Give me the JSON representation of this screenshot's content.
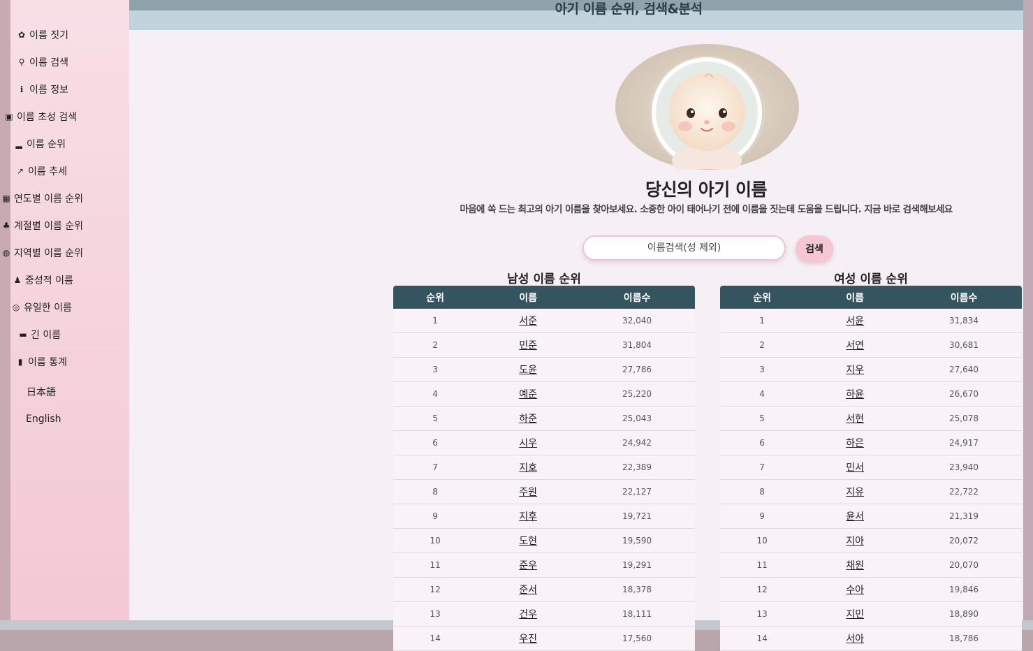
{
  "site_title": "아기 이름 순위, 검색&분석",
  "sidebar": {
    "items": [
      {
        "icon": "baby-icon",
        "glyph": "✿",
        "label": "이름 짓기"
      },
      {
        "icon": "search-icon",
        "glyph": "⚲",
        "label": "이름 검색"
      },
      {
        "icon": "info-icon",
        "glyph": "ℹ",
        "label": "이름 정보"
      },
      {
        "icon": "language-icon",
        "glyph": "▣",
        "label": "이름 초성 검색"
      },
      {
        "icon": "ranking-icon",
        "glyph": "▂",
        "label": "이름 순위"
      },
      {
        "icon": "trend-icon",
        "glyph": "↗",
        "label": "이름 추세"
      },
      {
        "icon": "calendar-icon",
        "glyph": "▦",
        "label": "연도별 이름 순위"
      },
      {
        "icon": "tree-icon",
        "glyph": "♣",
        "label": "계절별 이름 순위"
      },
      {
        "icon": "globe-icon",
        "glyph": "◍",
        "label": "지역별 이름 순위"
      },
      {
        "icon": "person-icon",
        "glyph": "♟",
        "label": "중성적 이름"
      },
      {
        "icon": "fingerprint-icon",
        "glyph": "◎",
        "label": "유일한 이름"
      },
      {
        "icon": "ruler-icon",
        "glyph": "▬",
        "label": "긴 이름"
      },
      {
        "icon": "chart-icon",
        "glyph": "▮",
        "label": "이름 통계"
      }
    ],
    "languages": [
      "日本語",
      "English"
    ]
  },
  "hero": {
    "title": "당신의 아기 이름",
    "subtitle": "마음에 쏙 드는 최고의 아기 이름을 찾아보세요. 소중한 아이 태어나기 전에 이름을 짓는데 도움을 드립니다. 지금 바로 검색해보세요"
  },
  "search": {
    "placeholder": "이름검색(성 제외)",
    "button": "검색"
  },
  "tables": {
    "headers": [
      "순위",
      "이름",
      "이름수"
    ],
    "male": {
      "title": "남성 이름 순위",
      "rows": [
        [
          "1",
          "서준",
          "32,040"
        ],
        [
          "2",
          "민준",
          "31,804"
        ],
        [
          "3",
          "도윤",
          "27,786"
        ],
        [
          "4",
          "예준",
          "25,220"
        ],
        [
          "5",
          "하준",
          "25,043"
        ],
        [
          "6",
          "시우",
          "24,942"
        ],
        [
          "7",
          "지호",
          "22,389"
        ],
        [
          "8",
          "주원",
          "22,127"
        ],
        [
          "9",
          "지후",
          "19,721"
        ],
        [
          "10",
          "도현",
          "19,590"
        ],
        [
          "11",
          "준우",
          "19,291"
        ],
        [
          "12",
          "준서",
          "18,378"
        ],
        [
          "13",
          "건우",
          "18,111"
        ],
        [
          "14",
          "우진",
          "17,560"
        ]
      ]
    },
    "female": {
      "title": "여성 이름 순위",
      "rows": [
        [
          "1",
          "서윤",
          "31,834"
        ],
        [
          "2",
          "서연",
          "30,681"
        ],
        [
          "3",
          "지우",
          "27,640"
        ],
        [
          "4",
          "하윤",
          "26,670"
        ],
        [
          "5",
          "서현",
          "25,078"
        ],
        [
          "6",
          "하은",
          "24,917"
        ],
        [
          "7",
          "민서",
          "23,940"
        ],
        [
          "8",
          "지유",
          "22,722"
        ],
        [
          "9",
          "윤서",
          "21,319"
        ],
        [
          "10",
          "지아",
          "20,072"
        ],
        [
          "11",
          "채원",
          "20,070"
        ],
        [
          "12",
          "수아",
          "19,846"
        ],
        [
          "13",
          "지민",
          "18,890"
        ],
        [
          "14",
          "서아",
          "18,786"
        ]
      ]
    }
  }
}
